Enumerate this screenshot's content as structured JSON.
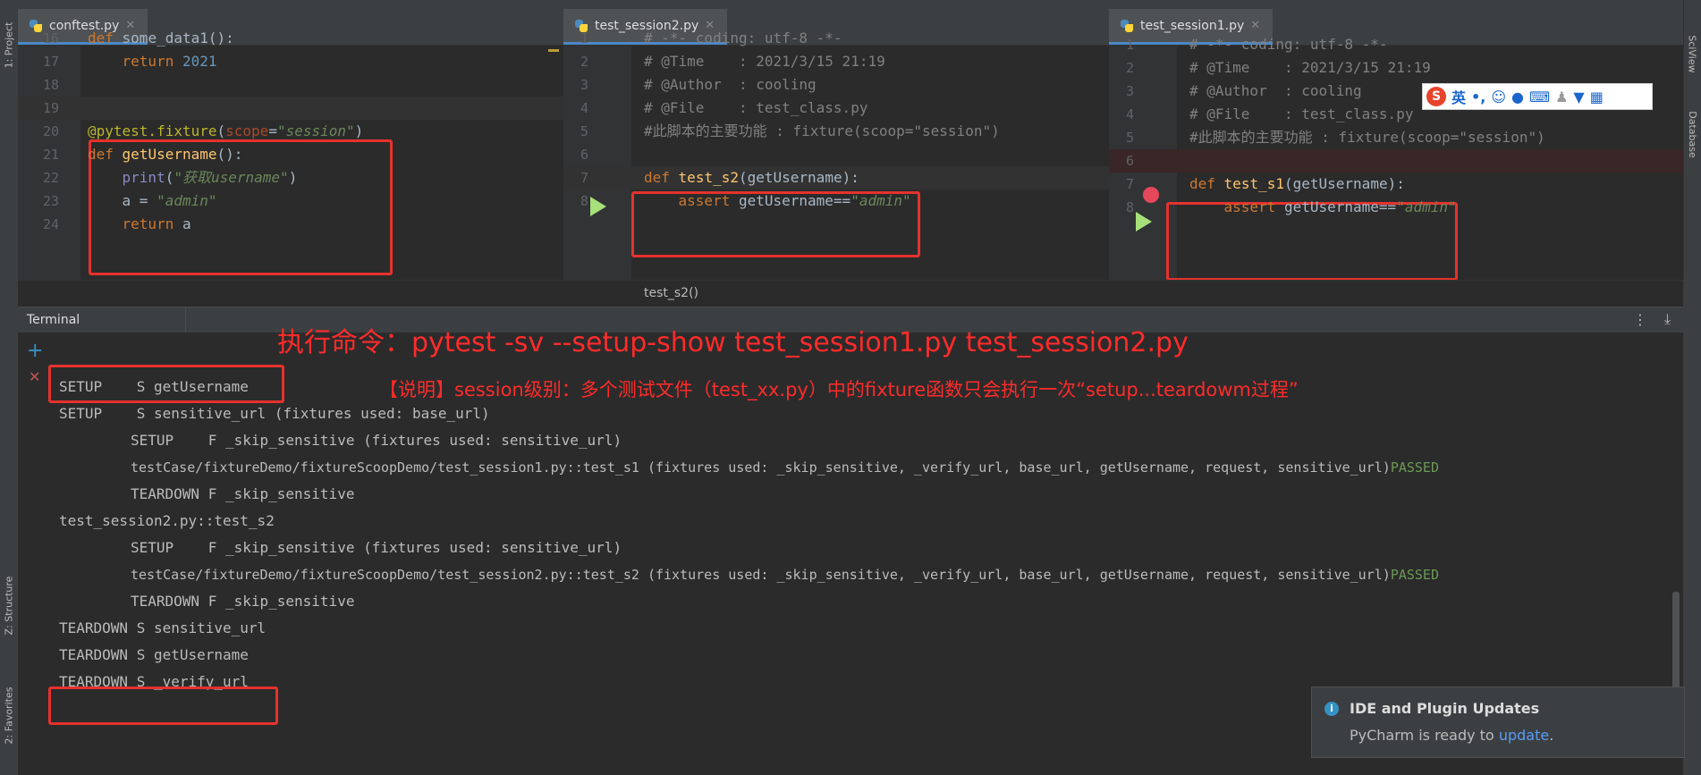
{
  "left_stripe": {
    "project": "1: Project",
    "structure": "Z: Structure",
    "favorites": "2: Favorites"
  },
  "right_stripe": {
    "top": "SciView",
    "db": "Database"
  },
  "panes": [
    {
      "tab": "conftest.py",
      "lines": [
        {
          "n": "16",
          "html": "<span class='kw'>def</span> some_data1():"
        },
        {
          "n": "17",
          "html": "    <span class='kw'>return</span> <span class='num'>2021</span>"
        },
        {
          "n": "18",
          "html": ""
        },
        {
          "n": "19",
          "html": ""
        },
        {
          "n": "20",
          "html": "<span class='deco'>@pytest.fixture</span>(<span class='param'>scope</span>=<span class='str'>\"session\"</span>)"
        },
        {
          "n": "21",
          "html": "<span class='kw'>def</span> <span class='fn'>getUsername</span>():"
        },
        {
          "n": "22",
          "html": "    <span class='builtin'>print</span>(<span class='str'>\"获取username\"</span>)"
        },
        {
          "n": "23",
          "html": "    a = <span class='str'>\"admin\"</span>"
        },
        {
          "n": "24",
          "html": "    <span class='kw'>return</span> a"
        }
      ]
    },
    {
      "tab": "test_session2.py",
      "lines": [
        {
          "n": "1",
          "html": "<span class='cmt'># -*- coding: utf-8 -*-</span>"
        },
        {
          "n": "2",
          "html": "<span class='cmt'># @Time    : 2021/3/15 21:19</span>"
        },
        {
          "n": "3",
          "html": "<span class='cmt'># @Author  : cooling</span>"
        },
        {
          "n": "4",
          "html": "<span class='cmt'># @File    : test_class.py</span>"
        },
        {
          "n": "5",
          "html": "<span class='cmt'>#此脚本的主要功能 : fixture(scoop=\"session\")</span>"
        },
        {
          "n": "6",
          "html": ""
        },
        {
          "n": "7",
          "html": "<span class='kw'>def</span> <span class='fn'>test_s2</span>(getUsername):"
        },
        {
          "n": "8",
          "html": "    <span class='kw'>assert</span> getUsername==<span class='str'>\"admin\"</span>"
        }
      ]
    },
    {
      "tab": "test_session1.py",
      "lines": [
        {
          "n": "1",
          "html": "<span class='cmt'># -*- coding: utf-8 -*-</span>"
        },
        {
          "n": "2",
          "html": "<span class='cmt'># @Time    : 2021/3/15 21:19</span>"
        },
        {
          "n": "3",
          "html": "<span class='cmt'># @Author  : cooling</span>"
        },
        {
          "n": "4",
          "html": "<span class='cmt'># @File    : test_class.py</span>"
        },
        {
          "n": "5",
          "html": "<span class='cmt'>#此脚本的主要功能 : fixture(scoop=\"session\")</span>"
        },
        {
          "n": "6",
          "html": ""
        },
        {
          "n": "7",
          "html": "<span class='kw'>def</span> <span class='fn'>test_s1</span>(getUsername):"
        },
        {
          "n": "8",
          "html": "    <span class='kw'>assert</span> getUsername==<span class='str'>\"admin\"</span>"
        }
      ]
    }
  ],
  "breadcrumb": "test_s2()",
  "terminal": {
    "tab": "Terminal",
    "add": "+",
    "close": "✕",
    "lines": [
      {
        "text": "SETUP    S getUsername",
        "indent": 0,
        "status": ""
      },
      {
        "text": "SETUP    S sensitive_url (fixtures used: base_url)",
        "indent": 0,
        "status": ""
      },
      {
        "text": "SETUP    F _skip_sensitive (fixtures used: sensitive_url)",
        "indent": 1,
        "status": ""
      },
      {
        "text": "testCase/fixtureDemo/fixtureScoopDemo/test_session1.py::test_s1 (fixtures used: _skip_sensitive, _verify_url, base_url, getUsername, request, sensitive_url)",
        "indent": 1,
        "status": "PASSED"
      },
      {
        "text": "TEARDOWN F _skip_sensitive",
        "indent": 1,
        "status": ""
      },
      {
        "text": "test_session2.py::test_s2",
        "indent": 0,
        "status": ""
      },
      {
        "text": "SETUP    F _skip_sensitive (fixtures used: sensitive_url)",
        "indent": 1,
        "status": ""
      },
      {
        "text": "testCase/fixtureDemo/fixtureScoopDemo/test_session2.py::test_s2 (fixtures used: _skip_sensitive, _verify_url, base_url, getUsername, request, sensitive_url)",
        "indent": 1,
        "status": "PASSED"
      },
      {
        "text": "TEARDOWN F _skip_sensitive",
        "indent": 1,
        "status": ""
      },
      {
        "text": "TEARDOWN S sensitive_url",
        "indent": 0,
        "status": ""
      },
      {
        "text": "TEARDOWN S getUsername",
        "indent": 0,
        "status": ""
      },
      {
        "text": "TEARDOWN S _verify_url",
        "indent": 0,
        "status": ""
      }
    ]
  },
  "annotations": {
    "command": "执行命令：pytest -sv --setup-show test_session1.py test_session2.py",
    "note": "【说明】session级别：多个测试文件（test_xx.py）中的fixture函数只会执行一次“setup...teardowm过程”"
  },
  "popup": {
    "title": "IDE and Plugin Updates",
    "body_prefix": "PyCharm is ready to ",
    "link": "update",
    "body_suffix": "."
  },
  "ime": {
    "logo": "S",
    "mode": "英"
  },
  "colors": {
    "accent": "#4a88c7",
    "annotation_red": "#ff2b2b",
    "box_red": "#e5322d",
    "passed_green": "#6a9955",
    "link": "#589df6"
  }
}
